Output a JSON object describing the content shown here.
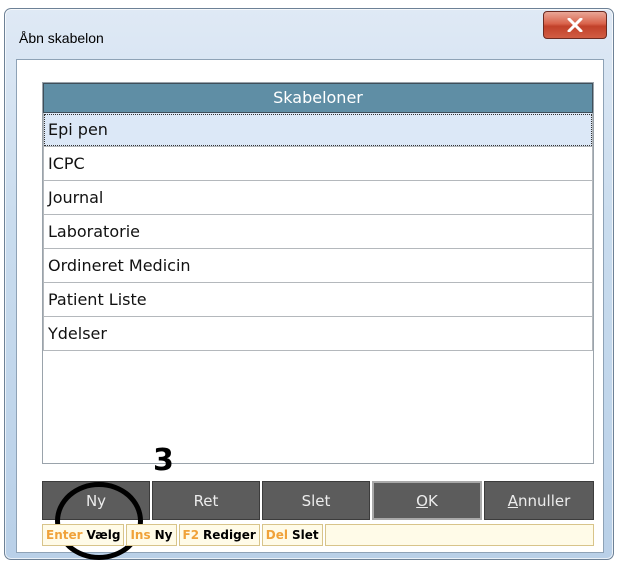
{
  "window": {
    "title": "Åbn skabelon",
    "close_icon": "close-icon"
  },
  "list": {
    "header": "Skabeloner",
    "items": [
      {
        "label": "Epi pen",
        "selected": true
      },
      {
        "label": "ICPC",
        "selected": false
      },
      {
        "label": "Journal",
        "selected": false
      },
      {
        "label": "Laboratorie",
        "selected": false
      },
      {
        "label": "Ordineret Medicin",
        "selected": false
      },
      {
        "label": "Patient Liste",
        "selected": false
      },
      {
        "label": "Ydelser",
        "selected": false
      }
    ]
  },
  "annotation": {
    "step": "3"
  },
  "buttons": {
    "new": "Ny",
    "edit": "Ret",
    "delete": "Slet",
    "ok_accel": "O",
    "ok_rest": "K",
    "cancel_accel": "A",
    "cancel_rest": "nnuller"
  },
  "hints": [
    {
      "key": "Enter",
      "action": "Vælg"
    },
    {
      "key": "Ins",
      "action": "Ny"
    },
    {
      "key": "F2",
      "action": "Rediger"
    },
    {
      "key": "Del",
      "action": "Slet"
    }
  ],
  "colors": {
    "header_bg": "#5f8ea5",
    "button_bg": "#5c5c5c",
    "hint_key": "#f0a23a",
    "close_button": "#d9634b",
    "selected_row": "#dce8f7"
  }
}
